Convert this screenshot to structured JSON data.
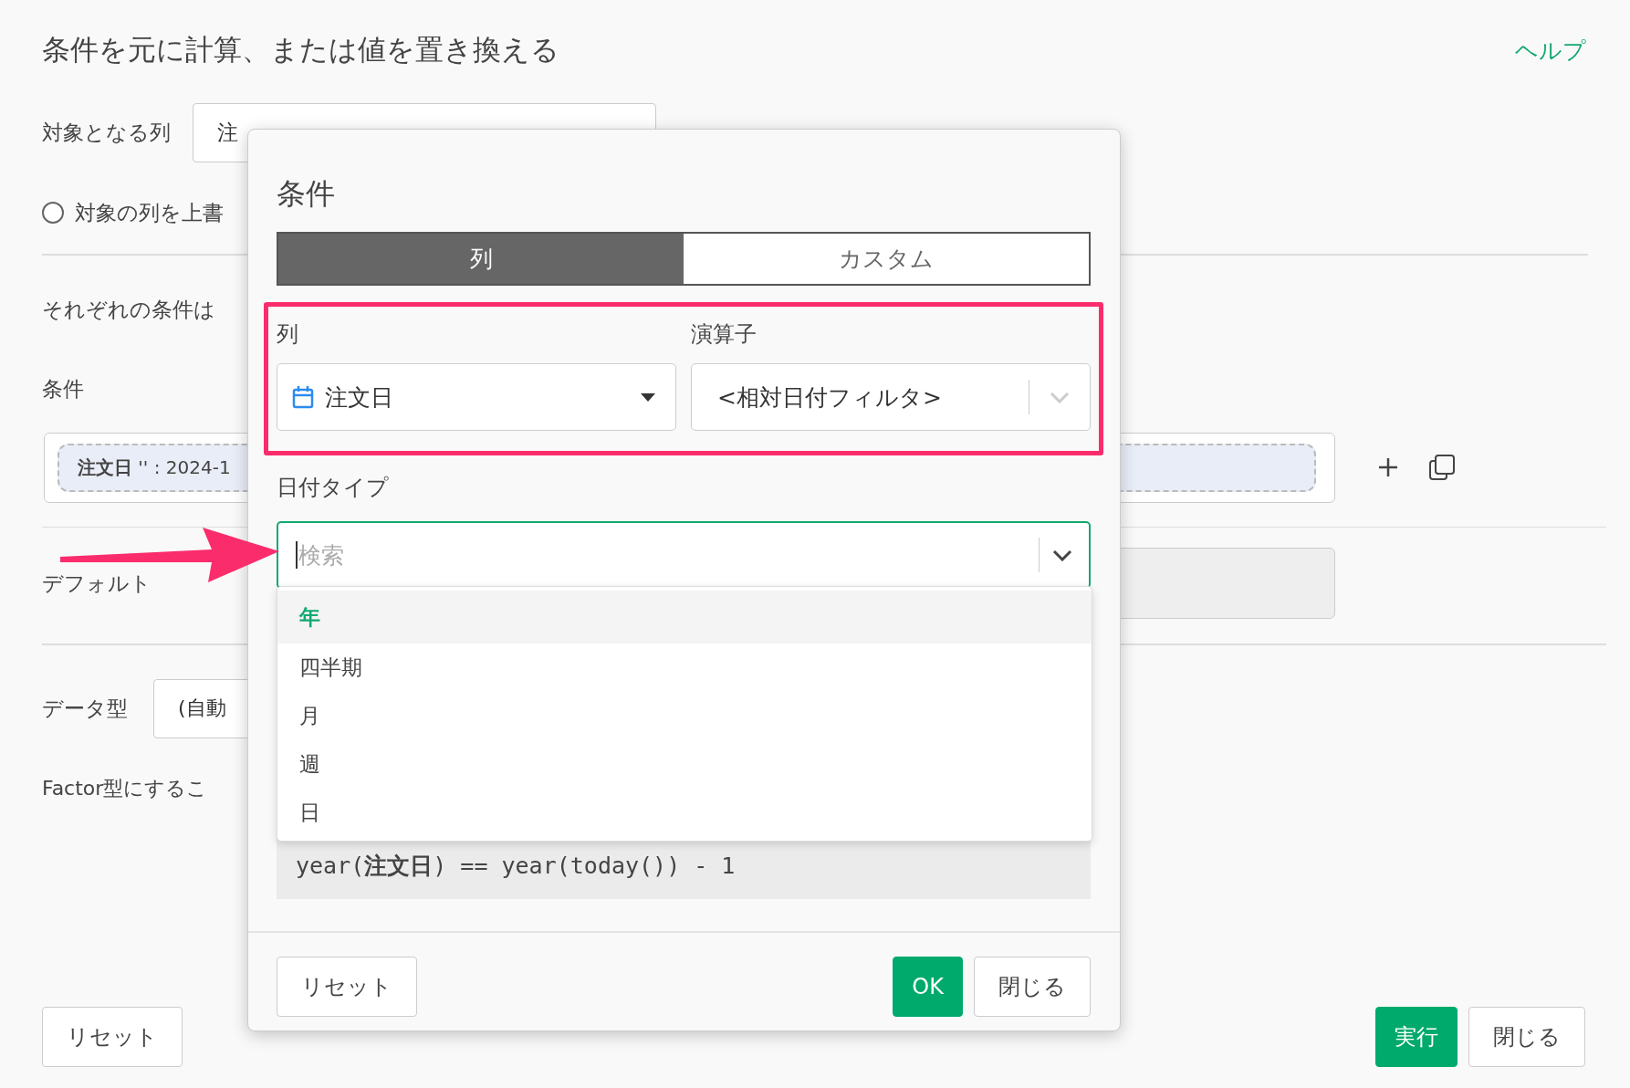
{
  "page": {
    "title": "条件を元に計算、または値を置き換える",
    "help_link": "ヘルプ"
  },
  "target_column": {
    "label": "対象となる列",
    "value": "注"
  },
  "overwrite_option": {
    "label": "対象の列を上書",
    "selected": false
  },
  "instructions": "それぞれの条件は",
  "conditions": {
    "label": "条件",
    "chip": "**注文日** '' : 2024-1"
  },
  "default": {
    "label": "デフォルト"
  },
  "data_type": {
    "label": "データ型",
    "value": "(自動"
  },
  "factor_note": "Factor型にするこ",
  "buttons": [
    {
      "label": "リセット",
      "kind": "secondary"
    },
    {
      "label": "実行",
      "kind": "primary"
    },
    {
      "label": "閉じる",
      "kind": "secondary"
    }
  ],
  "dialog": {
    "title": "条件",
    "tabs": [
      {
        "label": "列",
        "selected": true
      },
      {
        "label": "カスタム",
        "selected": false
      }
    ],
    "column": {
      "label": "列",
      "value": "注文日"
    },
    "operator": {
      "label": "演算子",
      "value": "<相対日付フィルタ>"
    },
    "date_type": {
      "label": "日付タイプ",
      "placeholder": "検索",
      "options": [
        {
          "label": "年",
          "selected": true
        },
        {
          "label": "四半期",
          "selected": false
        },
        {
          "label": "月",
          "selected": false
        },
        {
          "label": "週",
          "selected": false
        },
        {
          "label": "日",
          "selected": false
        }
      ]
    },
    "expression": "year(**注文日**) == year(today()) - 1",
    "buttons": [
      {
        "label": "リセット",
        "kind": "secondary"
      },
      {
        "label": "OK",
        "kind": "primary"
      },
      {
        "label": "閉じる",
        "kind": "secondary"
      }
    ]
  }
}
